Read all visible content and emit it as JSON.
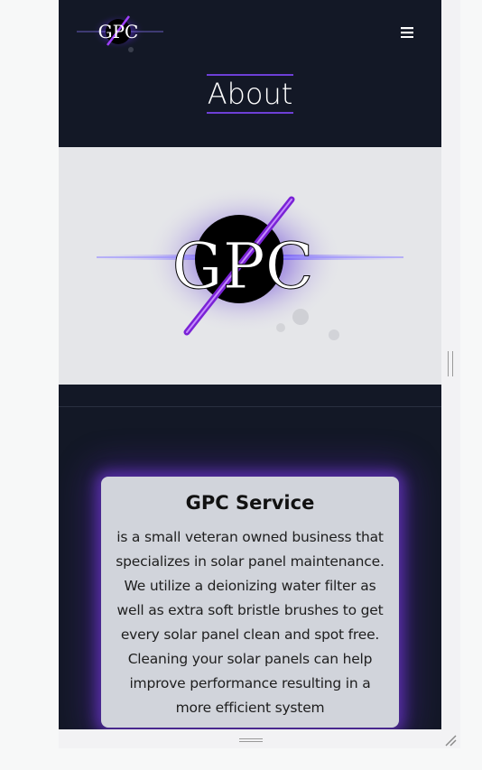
{
  "header": {
    "logo_text": "GPC",
    "menu_icon": "hamburger-icon",
    "page_title": "About"
  },
  "hero": {
    "logo_text": "GPC"
  },
  "service_card": {
    "title": "GPC Service",
    "body": "is a small veteran owned business that specializes in solar panel maintenance. We utilize a deionizing water filter as well as extra soft bristle brushes to get every solar panel clean and spot free. Cleaning your solar panels can help improve performance resulting in a more efficient system"
  },
  "colors": {
    "background": "#131826",
    "accent": "#6d3fd6",
    "card": "#d1d4db"
  }
}
